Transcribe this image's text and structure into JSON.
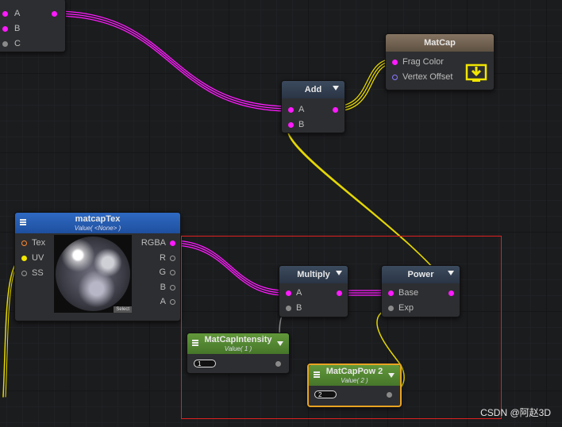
{
  "nodes": {
    "top_left": {
      "ports": [
        "A",
        "B",
        "C"
      ]
    },
    "add": {
      "title": "Add",
      "inputs": [
        "A",
        "B"
      ]
    },
    "matcap": {
      "title": "MatCap",
      "inputs": [
        "Frag Color",
        "Vertex Offset"
      ]
    },
    "matcap_tex": {
      "title": "matcapTex",
      "subtitle": "Value( <None> )",
      "inputs": [
        "Tex",
        "UV",
        "SS"
      ],
      "outputs": [
        "RGBA",
        "R",
        "G",
        "B",
        "A"
      ],
      "select_label": "Select"
    },
    "multiply": {
      "title": "Multiply",
      "inputs": [
        "A",
        "B"
      ]
    },
    "power": {
      "title": "Power",
      "inputs": [
        "Base",
        "Exp"
      ]
    },
    "matcap_intensity": {
      "title": "MatCapIntensity",
      "subtitle": "Value( 1 )",
      "value": "1"
    },
    "matcap_pow": {
      "title": "MatCapPow 2",
      "subtitle": "Value( 2 )",
      "value": "2"
    }
  },
  "watermark": "CSDN @阿赵3D",
  "colors": {
    "vector_wire": "#ff1aff",
    "scalar_wire": "#f2e600",
    "highlight_box": "#e02020"
  }
}
